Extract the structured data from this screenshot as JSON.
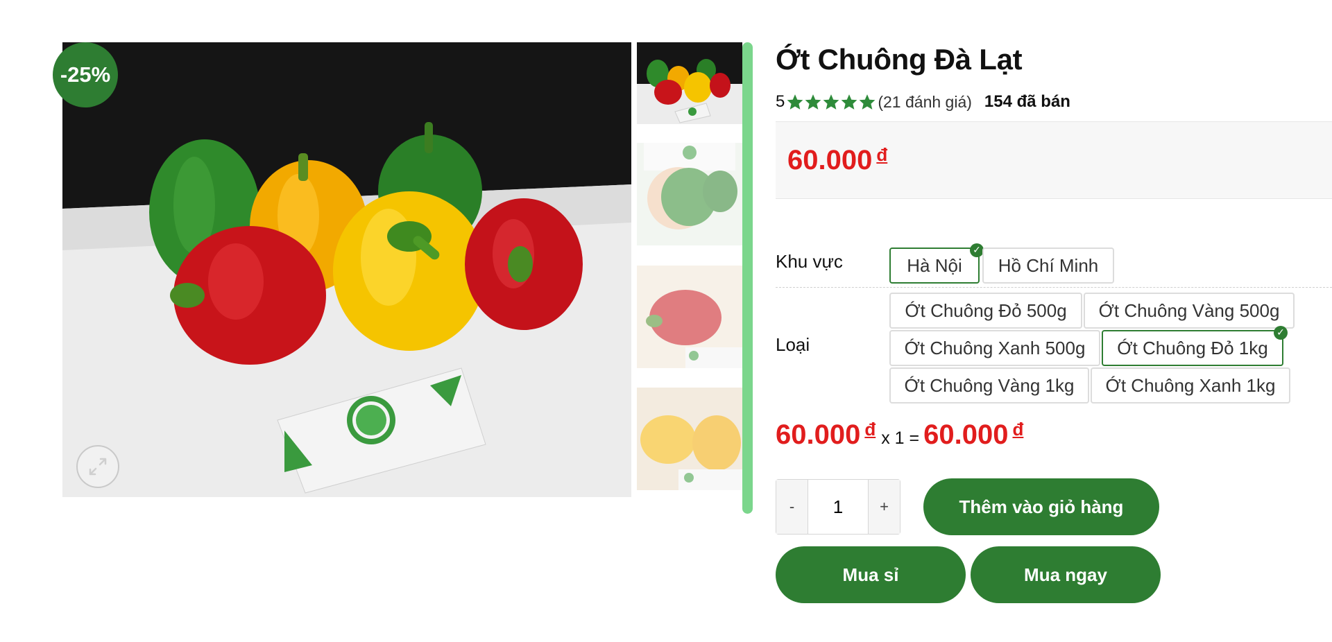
{
  "product": {
    "title": "Ớt Chuông Đà Lạt",
    "rating_value": "5",
    "review_count": "(21 đánh giá)",
    "sold": "154 đã bán",
    "discount": "-25%",
    "price": "60.000",
    "currency": "đ"
  },
  "options": {
    "region": {
      "label": "Khu vực",
      "items": [
        "Hà Nội",
        "Hồ Chí Minh"
      ],
      "selected": "Hà Nội"
    },
    "type": {
      "label": "Loại",
      "items": [
        "Ớt Chuông Đỏ 500g",
        "Ớt Chuông Vàng 500g",
        "Ớt Chuông Xanh 500g",
        "Ớt Chuông Đỏ 1kg",
        "Ớt Chuông Vàng 1kg",
        "Ớt Chuông Xanh 1kg"
      ],
      "selected": "Ớt Chuông Đỏ 1kg"
    }
  },
  "total": {
    "unit_price": "60.000",
    "currency": "đ",
    "multiplier": "x 1 =",
    "total_price": "60.000"
  },
  "quantity": {
    "minus": "-",
    "value": "1",
    "plus": "+"
  },
  "actions": {
    "add_to_cart": "Thêm vào giỏ hàng",
    "wholesale": "Mua sỉ",
    "buy_now": "Mua ngay"
  },
  "colors": {
    "accent": "#2e7d32",
    "price": "#e11d1d",
    "scrollbar": "#7bd68c"
  },
  "icons": {
    "zoom": "expand-icon",
    "star": "star-icon",
    "check": "check-icon"
  }
}
